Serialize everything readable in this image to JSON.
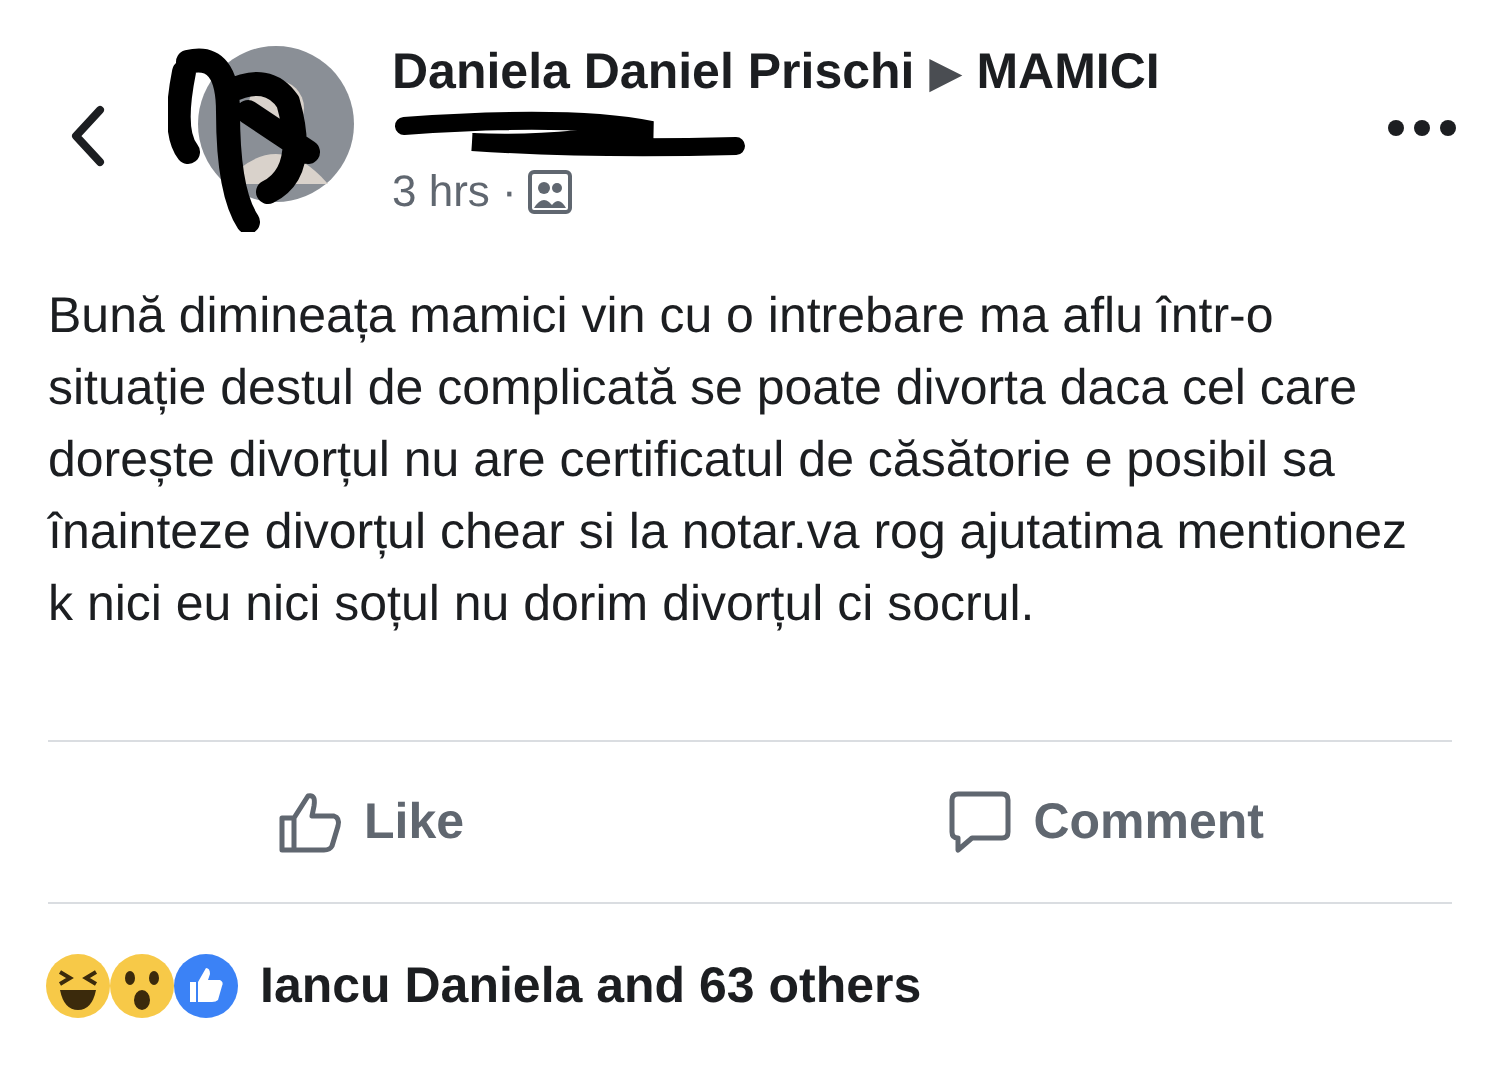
{
  "post": {
    "author": "Daniela Daniel Prischi",
    "separator": "▶",
    "group": "MAMICI",
    "time": "3 hrs ·",
    "text": "Bună dimineața mamici vin cu o intrebare ma aflu într-o situație destul de complicată se poate divorta daca cel care dorește divorțul nu are certificatul de căsătorie e posibil sa înainteze divorțul chear si la notar.va rog ajutatima mentionez k nici eu nici soțul nu dorim divorțul ci socrul."
  },
  "actions": [
    {
      "kind": "like",
      "label": "Like"
    },
    {
      "kind": "comment",
      "label": "Comment"
    }
  ],
  "reactions": {
    "icons": [
      {
        "kind": "haha"
      },
      {
        "kind": "wow"
      },
      {
        "kind": "like"
      }
    ],
    "summary": "Iancu Daniela and 63 others"
  }
}
